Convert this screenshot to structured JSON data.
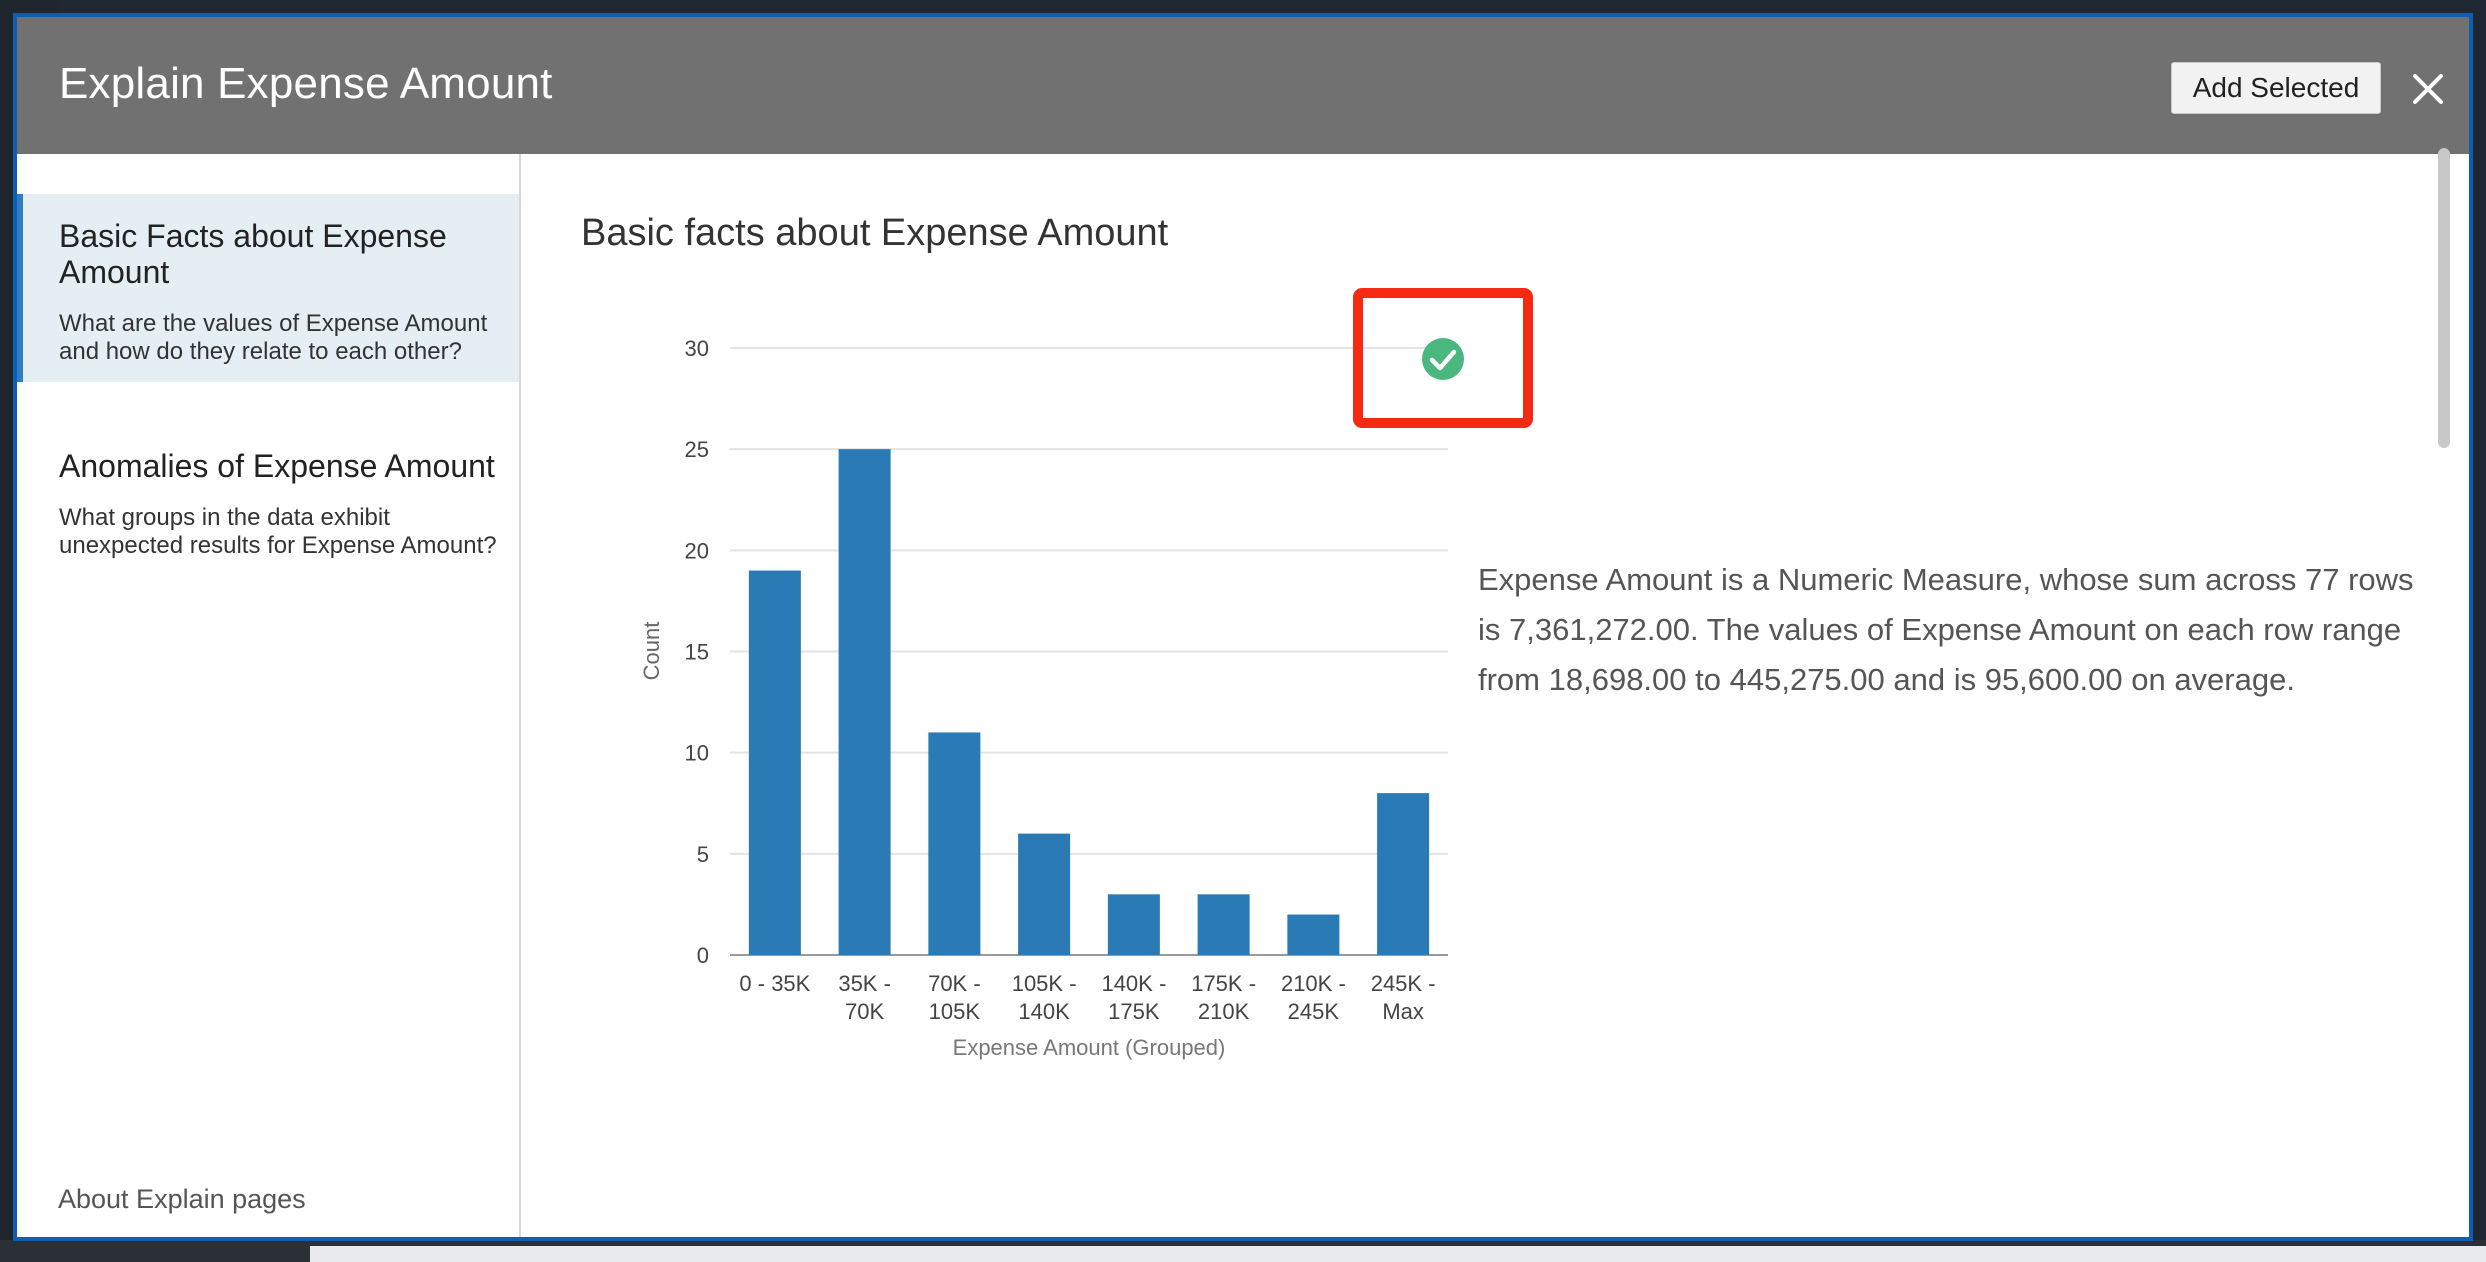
{
  "dialog": {
    "title": "Explain Expense Amount",
    "add_selected_label": "Add Selected"
  },
  "sidebar": {
    "items": [
      {
        "title": "Basic Facts about Expense Amount",
        "description": "What are the values of Expense Amount and how do they relate to each other?",
        "active": true
      },
      {
        "title": "Anomalies of Expense Amount",
        "description": "What groups in the data exhibit unexpected results for Expense Amount?",
        "active": false
      }
    ],
    "about_link": "About Explain pages"
  },
  "main": {
    "section_title": "Basic facts about Expense Amount",
    "explanation": "Expense Amount is a Numeric Measure, whose sum across 77 rows is 7,361,272.00. The values of Expense Amount on each row range from 18,698.00 to 445,275.00 and is 95,600.00 on average."
  },
  "colors": {
    "bar": "#2a7ab5",
    "header": "#717171",
    "active_accent": "#2f7cc2",
    "select_check": "#49b77e",
    "highlight": "#f62a12"
  },
  "icons": {
    "close": "close-icon",
    "select": "check-circle-icon"
  },
  "chart_data": {
    "type": "bar",
    "categories": [
      [
        "0 - 35K"
      ],
      [
        "35K -",
        "70K"
      ],
      [
        "70K -",
        "105K"
      ],
      [
        "105K -",
        "140K"
      ],
      [
        "140K -",
        "175K"
      ],
      [
        "175K -",
        "210K"
      ],
      [
        "210K -",
        "245K"
      ],
      [
        "245K -",
        "Max"
      ]
    ],
    "values": [
      19,
      25,
      11,
      6,
      3,
      3,
      2,
      8
    ],
    "xlabel": "Expense Amount (Grouped)",
    "ylabel": "Count",
    "ylim": [
      0,
      30
    ],
    "yticks": [
      0,
      5,
      10,
      15,
      20,
      25,
      30
    ],
    "grid": true,
    "legend": "none"
  }
}
